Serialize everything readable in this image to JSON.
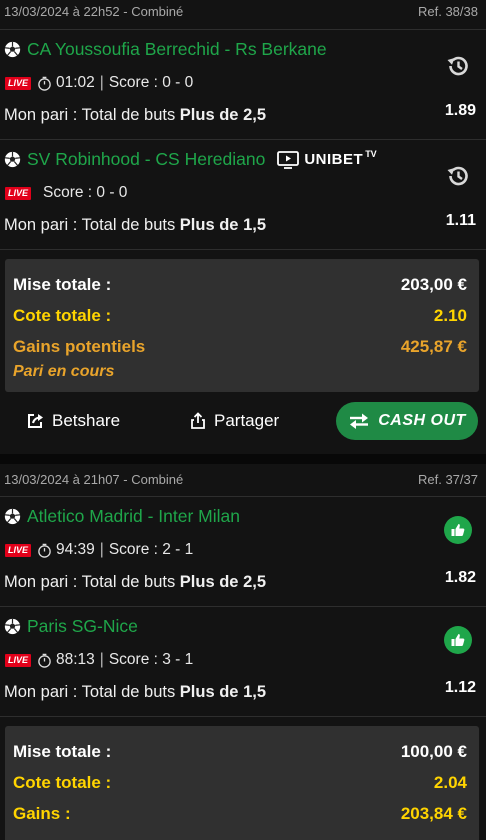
{
  "bets": [
    {
      "header": {
        "date": "13/03/2024 à 22h52 - Combiné",
        "ref": "Ref. 38/38"
      },
      "selections": [
        {
          "match": "CA Youssoufia Berrechid - Rs Berkane",
          "live": "LIVE",
          "time": "01:02",
          "score": "Score : 0 - 0",
          "pari_prefix": "Mon pari : Total de buts ",
          "pari_bold": "Plus de 2,5",
          "odd": "1.89",
          "status_icon": "history-icon"
        },
        {
          "match": "SV Robinhood - CS Herediano",
          "stream": {
            "brand": "UNIBET",
            "suffix": "TV"
          },
          "live": "LIVE",
          "score": "Score : 0 - 0",
          "pari_prefix": "Mon pari : Total de buts ",
          "pari_bold": "Plus de 1,5",
          "odd": "1.11",
          "status_icon": "history-icon"
        }
      ],
      "summary": {
        "mise_label": "Mise totale :",
        "mise_value": "203,00 €",
        "cote_label": "Cote totale :",
        "cote_value": "2.10",
        "gains_label": "Gains potentiels",
        "gains_value": "425,87 €",
        "status": "Pari en cours"
      },
      "actions": {
        "betshare": "Betshare",
        "partager": "Partager",
        "cashout": "CASH OUT"
      }
    },
    {
      "header": {
        "date": "13/03/2024 à 21h07 - Combiné",
        "ref": "Ref. 37/37"
      },
      "selections": [
        {
          "match": "Atletico Madrid - Inter Milan",
          "live": "LIVE",
          "time": "94:39",
          "score": "Score : 2 - 1",
          "pari_prefix": "Mon pari : Total de buts ",
          "pari_bold": "Plus de 2,5",
          "odd": "1.82",
          "status_icon": "thumbs-up-icon"
        },
        {
          "match": "Paris SG-Nice",
          "live": "LIVE",
          "time": "88:13",
          "score": "Score : 3 - 1",
          "pari_prefix": "Mon pari : Total de buts ",
          "pari_bold": "Plus de 1,5",
          "odd": "1.12",
          "status_icon": "thumbs-up-icon"
        }
      ],
      "summary": {
        "mise_label": "Mise totale :",
        "mise_value": "100,00 €",
        "cote_label": "Cote totale :",
        "cote_value": "2.04",
        "gains_label": "Gains :",
        "gains_value": "203,84 €"
      }
    }
  ],
  "colors": {
    "green": "#1fa64a",
    "yellow": "#ffd400",
    "orange": "#e9a42b",
    "live_red": "#e2001a",
    "cashout_bg": "#1f8a45"
  }
}
